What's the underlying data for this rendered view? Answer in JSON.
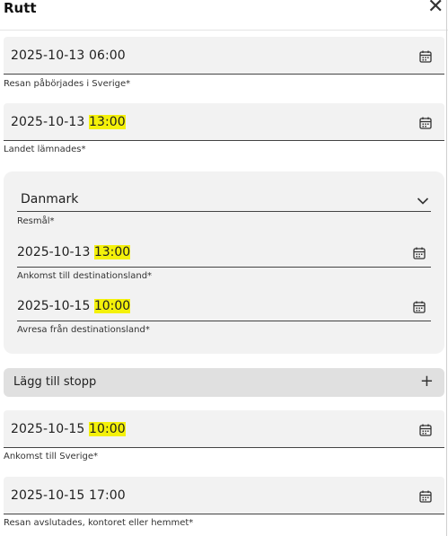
{
  "dialog": {
    "title": "Rutt"
  },
  "trip_start": {
    "date": "2025-10-13",
    "time": "06:00",
    "caption": "Resan påbörjades i Sverige*"
  },
  "country_left": {
    "date": "2025-10-13",
    "time": "13:00",
    "caption": "Landet lämnades*"
  },
  "destination": {
    "country": {
      "value": "Danmark",
      "caption": "Resmål*"
    },
    "arrival": {
      "date": "2025-10-13",
      "time": "13:00",
      "caption": "Ankomst till destinationsland*"
    },
    "departure": {
      "date": "2025-10-15",
      "time": "10:00",
      "caption": "Avresa från destinationsland*"
    }
  },
  "add_stop": {
    "label": "Lägg till stopp",
    "icon": "+"
  },
  "arrival_sweden": {
    "date": "2025-10-15",
    "time": "10:00",
    "caption": "Ankomst till Sverige*"
  },
  "trip_end": {
    "date": "2025-10-15",
    "time": "17:00",
    "caption": "Resan avslutades, kontoret eller hemmet*"
  },
  "highlight_color": "#f4f10a"
}
